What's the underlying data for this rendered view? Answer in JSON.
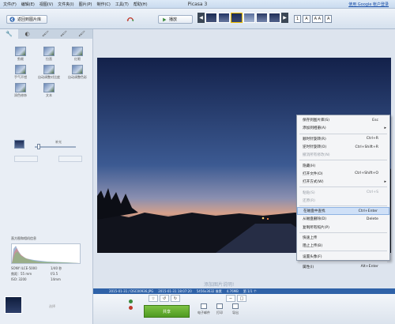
{
  "window": {
    "title": "Picasa 3",
    "menus": [
      "文件(F)",
      "编辑(E)",
      "视图(V)",
      "文件夹(I)",
      "图片(P)",
      "制作(C)",
      "工具(T)",
      "帮助(H)"
    ],
    "signin": "使用 Google 帐户登录"
  },
  "toolbar": {
    "back_label": "返回到图片库",
    "play_label": "播放",
    "view_buttons": [
      "1",
      "A",
      "A A",
      "A"
    ],
    "filmstrip_count": 6
  },
  "left_panel": {
    "tabs": [
      "wrench",
      "drop",
      "brush",
      "brush2",
      "brush3"
    ],
    "fixes": [
      "剪裁",
      "拉直",
      "红眼",
      "手气不错",
      "自动调整对比度",
      "自动调整色彩",
      "润色修饰",
      "文本"
    ],
    "fill_light_label": "补光",
    "fill_light_level": 0.05,
    "histogram_title": "直方图和相机信息",
    "exif": [
      [
        "SONY ILCE-5000",
        "1/40 秒"
      ],
      [
        "焦距：55 mm",
        "f/3.5"
      ],
      [
        "ISO: 3200",
        "14mm"
      ]
    ]
  },
  "context_menu": {
    "items": [
      {
        "label": "保存到图片库(S)",
        "shortcut": "Esc",
        "disabled": false
      },
      {
        "label": "添加到相册(A)",
        "submenu": true,
        "disabled": false
      },
      {
        "sep": true
      },
      {
        "label": "顺时针旋转(R)",
        "shortcut": "Ctrl+R",
        "disabled": false
      },
      {
        "label": "逆时针旋转(O)",
        "shortcut": "Ctrl+Shift+R",
        "disabled": false
      },
      {
        "label": "撤消所有修改(N)",
        "disabled": true
      },
      {
        "sep": true
      },
      {
        "label": "隐藏(H)",
        "disabled": false
      },
      {
        "label": "打开文件(O)",
        "shortcut": "Ctrl+Shift+O",
        "disabled": false
      },
      {
        "label": "打开方式(W)",
        "submenu": true,
        "disabled": false
      },
      {
        "sep": true
      },
      {
        "label": "粘贴(S)",
        "shortcut": "Ctrl+S",
        "disabled": true
      },
      {
        "label": "还原(R)",
        "disabled": true
      },
      {
        "sep": true
      },
      {
        "label": "在磁盘中查找",
        "shortcut": "Ctrl+Enter",
        "disabled": false,
        "highlight": true
      },
      {
        "label": "从磁盘删除(D)",
        "shortcut": "Delete",
        "disabled": false
      },
      {
        "label": "复制所有照片(P)",
        "disabled": false
      },
      {
        "sep": true
      },
      {
        "label": "快速上传",
        "disabled": false
      },
      {
        "label": "阻止上传(B)",
        "disabled": false
      },
      {
        "sep": true
      },
      {
        "label": "设置头像(F)",
        "disabled": false
      },
      {
        "sep": true
      },
      {
        "label": "属性(I)",
        "shortcut": "Alt+Enter",
        "disabled": false
      }
    ]
  },
  "main": {
    "caption": "添加图片说明!"
  },
  "status": {
    "items": [
      "2015-01-31 / DSC00936.JPG",
      "2015-01-31 18:07:20",
      "5456x3632 像素",
      "4.76MB",
      "第 1/1 个"
    ]
  },
  "tray": {
    "label": "选择"
  },
  "bottom": {
    "share_label": "共享",
    "icons": [
      "电子邮件",
      "打印",
      "导出"
    ]
  }
}
